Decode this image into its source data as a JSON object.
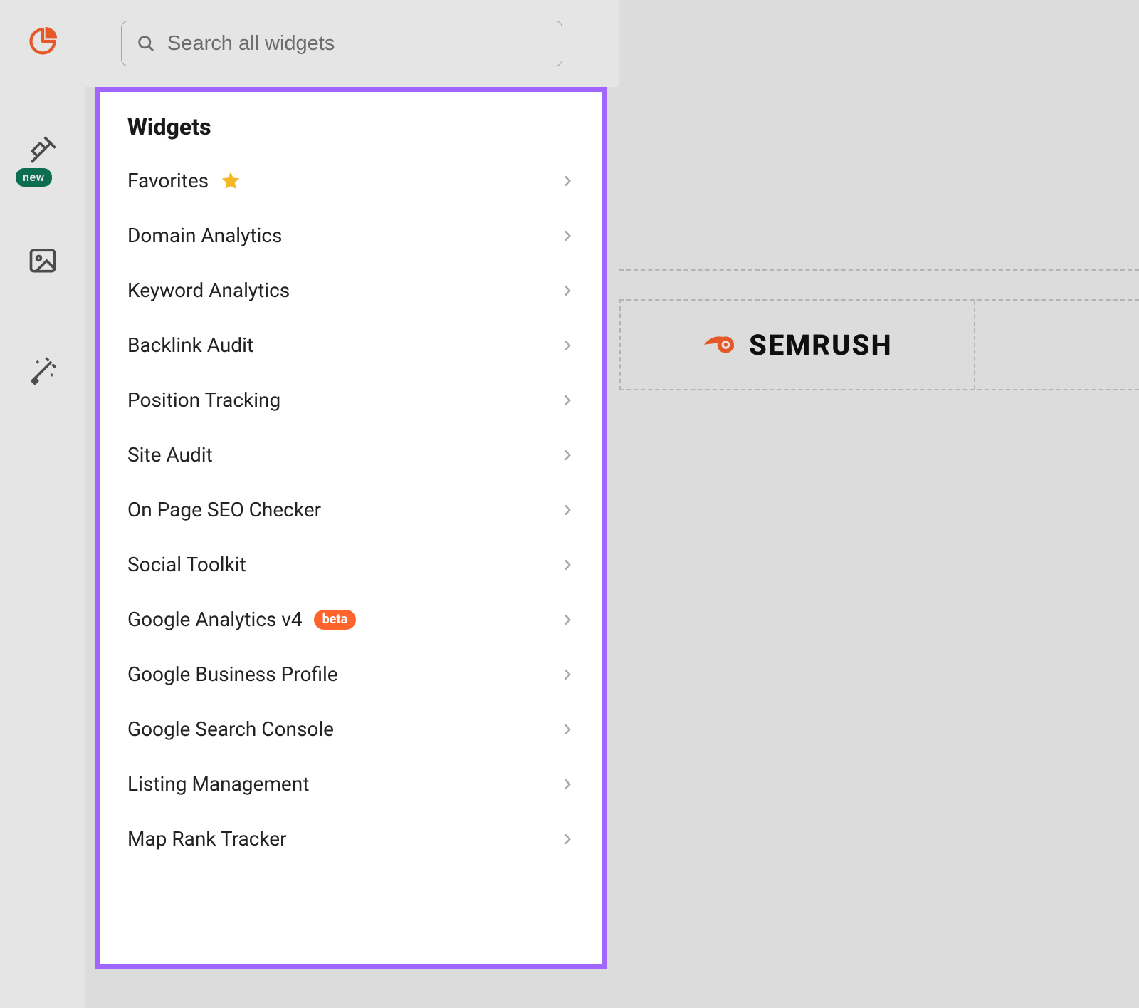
{
  "rail": {
    "new_badge": "new"
  },
  "search": {
    "placeholder": "Search all widgets"
  },
  "panel": {
    "title": "Widgets",
    "items": [
      {
        "label": "Favorites",
        "star": true
      },
      {
        "label": "Domain Analytics"
      },
      {
        "label": "Keyword Analytics"
      },
      {
        "label": "Backlink Audit"
      },
      {
        "label": "Position Tracking"
      },
      {
        "label": "Site Audit"
      },
      {
        "label": "On Page SEO Checker"
      },
      {
        "label": "Social Toolkit"
      },
      {
        "label": "Google Analytics v4",
        "beta": "beta"
      },
      {
        "label": "Google Business Profile"
      },
      {
        "label": "Google Search Console"
      },
      {
        "label": "Listing Management"
      },
      {
        "label": "Map Rank Tracker"
      }
    ]
  },
  "brand": {
    "name": "SEMRUSH"
  },
  "colors": {
    "accent_purple": "#a166ff",
    "brand_orange": "#ff642d",
    "star_yellow": "#f5b725",
    "badge_green": "#0f7a5a"
  }
}
